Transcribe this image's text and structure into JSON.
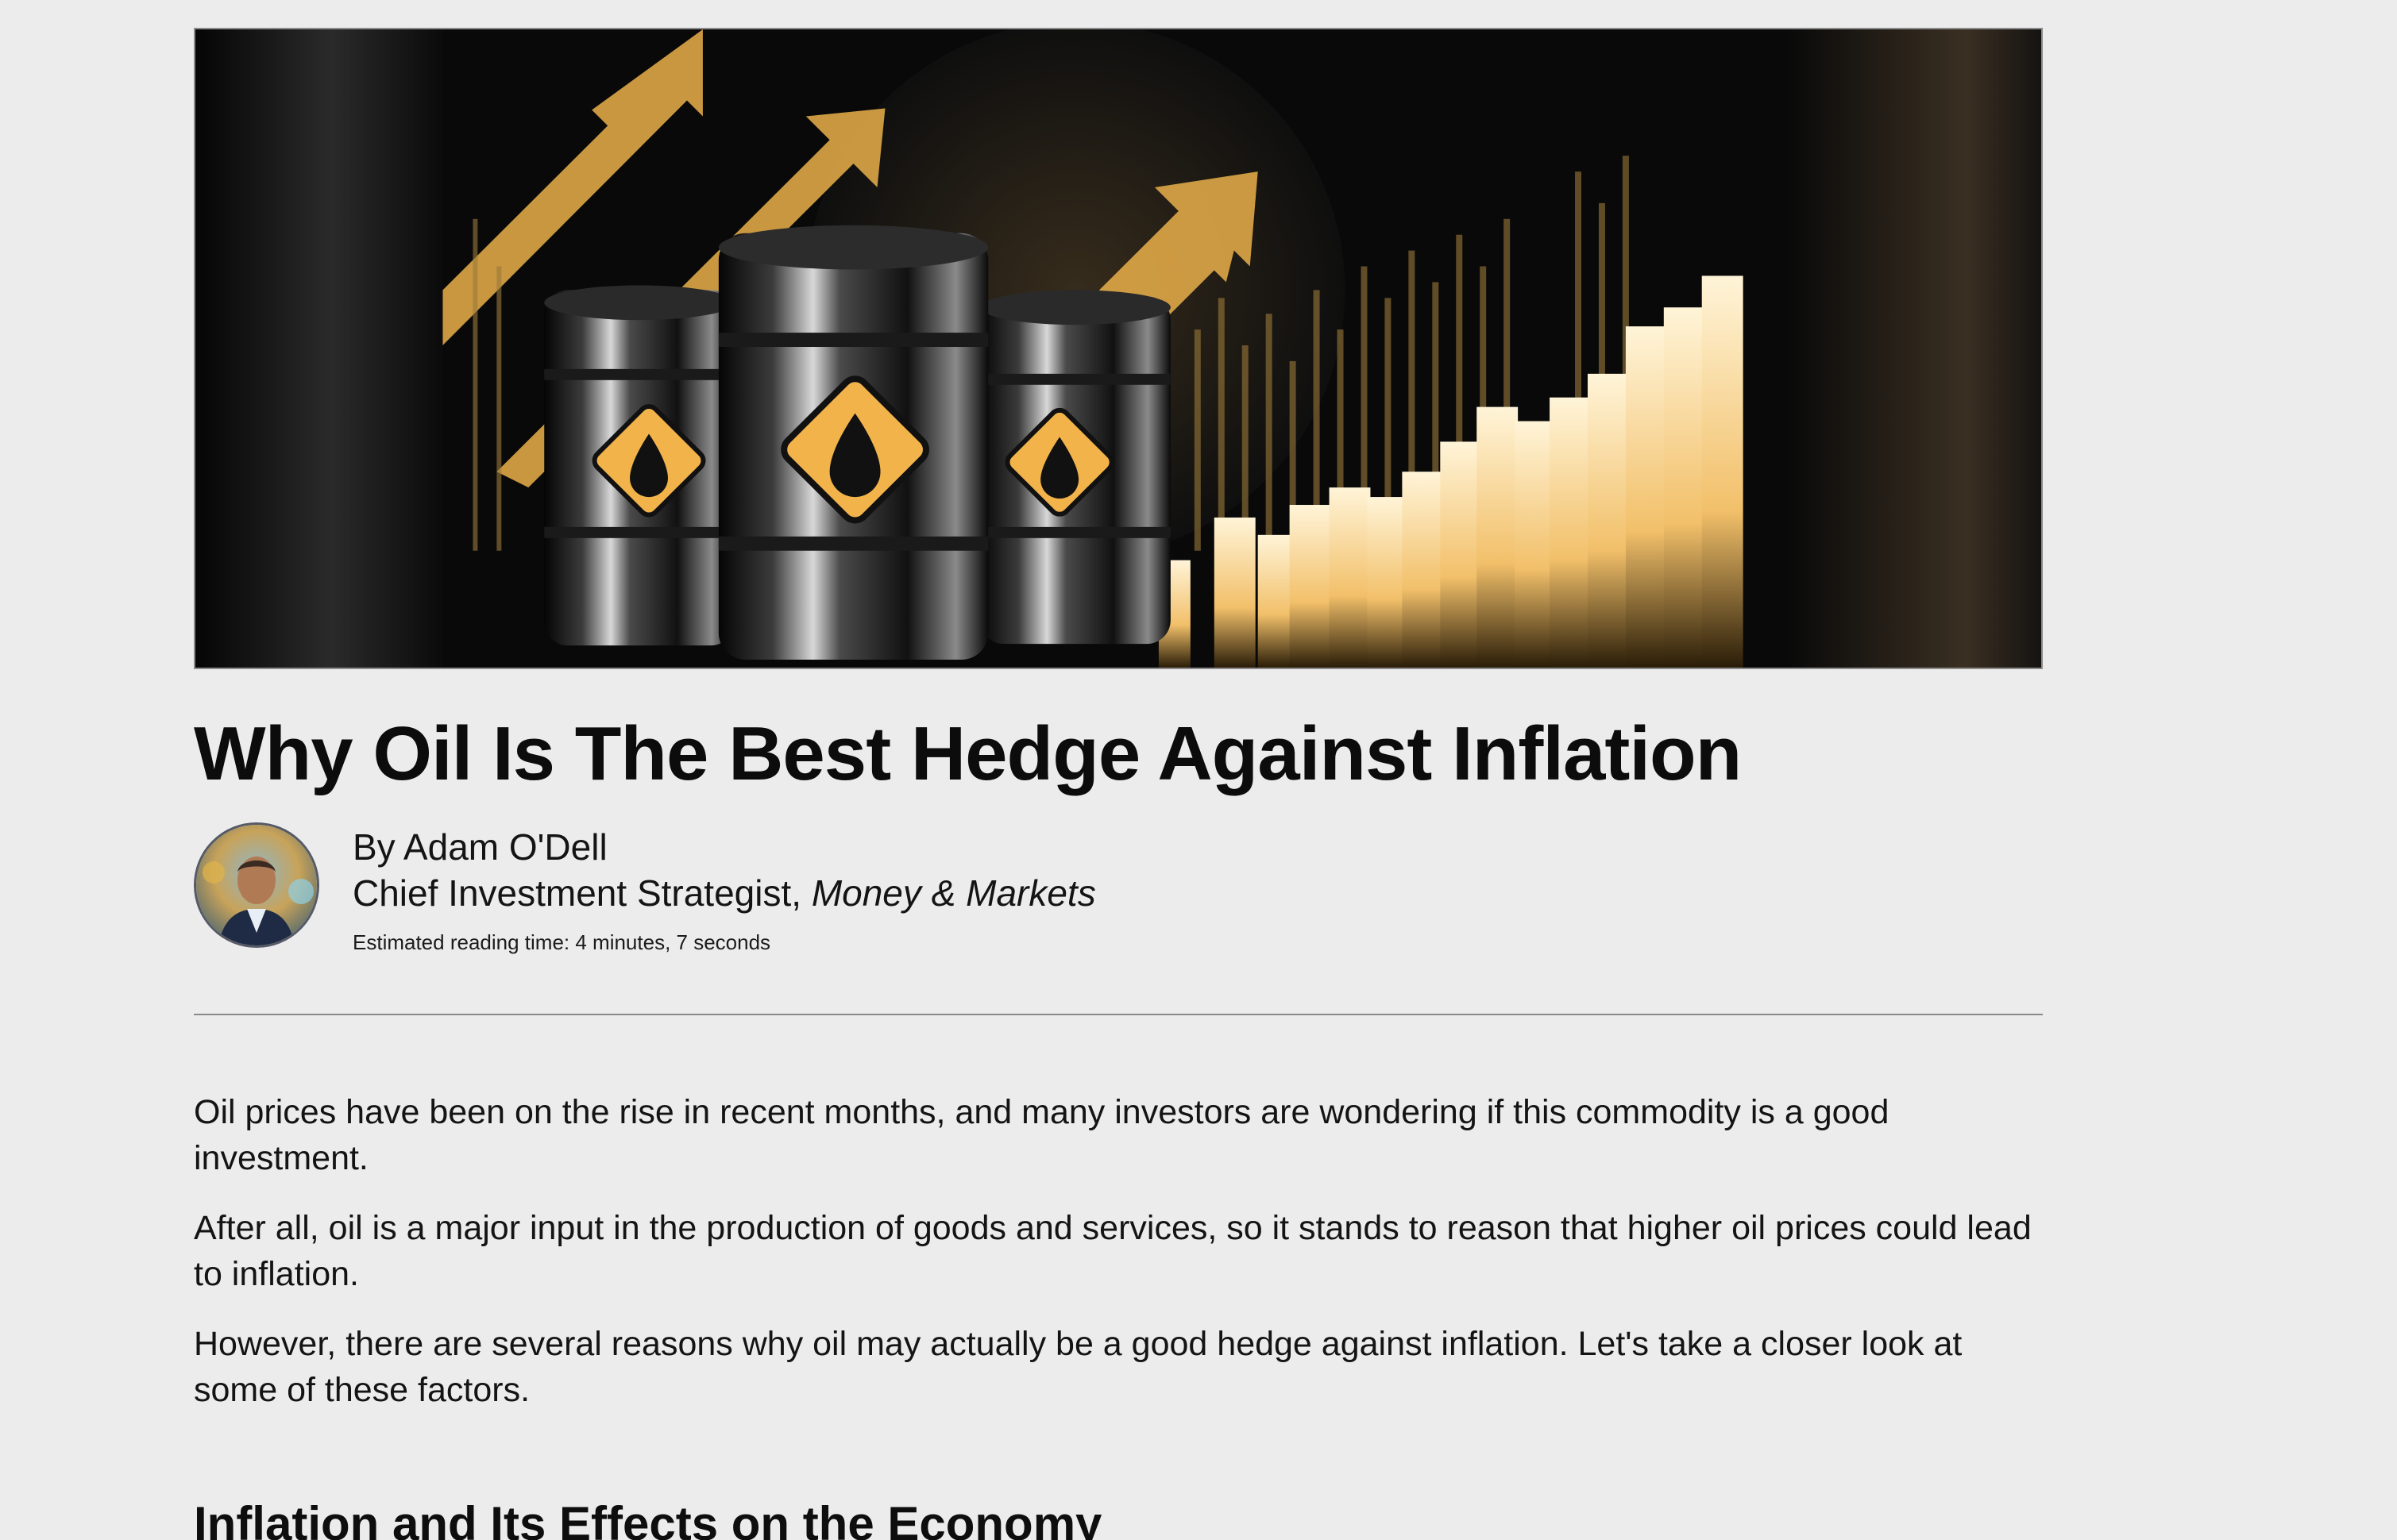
{
  "article": {
    "title": "Why Oil Is The Best Hedge Against Inflation",
    "author_line": "By Adam O'Dell",
    "author_role": "Chief Investment Strategist,",
    "publication": "Money & Markets",
    "reading_time": "Estimated reading time: 4 minutes, 7 seconds",
    "paragraphs": [
      "Oil prices have been on the rise in recent months, and many investors are wondering if this commodity is a good investment.",
      "After all, oil is a major input in the production of goods and services, so it stands to reason that higher oil prices could lead to inflation.",
      "However, there are several reasons why oil may actually be a good hedge against inflation. Let's take a closer look at some of these factors."
    ],
    "subheading": "Inflation and Its Effects on the Economy"
  },
  "hero_image": {
    "icon": "oil-barrels-rising-chart-illustration",
    "colors": {
      "gold": "#f0b24a",
      "background": "#0a0a0a"
    }
  },
  "author_avatar": {
    "icon": "author-portrait"
  }
}
